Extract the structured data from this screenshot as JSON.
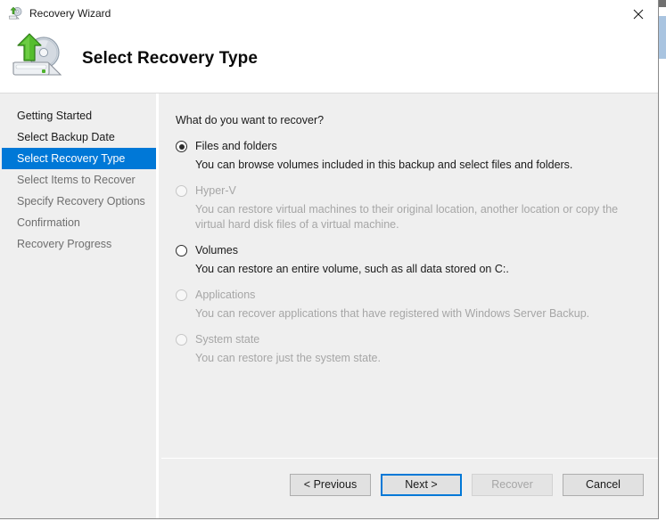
{
  "window": {
    "title": "Recovery Wizard",
    "title_icon": "recovery-disk-icon",
    "close_icon": "close-icon"
  },
  "header": {
    "icon": "recovery-disk-icon",
    "title": "Select Recovery Type"
  },
  "sidebar": {
    "items": [
      {
        "label": "Getting Started",
        "state": "done"
      },
      {
        "label": "Select Backup Date",
        "state": "done"
      },
      {
        "label": "Select Recovery Type",
        "state": "current"
      },
      {
        "label": "Select Items to Recover",
        "state": "upcoming"
      },
      {
        "label": "Specify Recovery Options",
        "state": "upcoming"
      },
      {
        "label": "Confirmation",
        "state": "upcoming"
      },
      {
        "label": "Recovery Progress",
        "state": "upcoming"
      }
    ]
  },
  "content": {
    "question": "What do you want to recover?",
    "options": [
      {
        "label": "Files and folders",
        "description": "You can browse volumes included in this backup and select files and folders.",
        "selected": true,
        "enabled": true
      },
      {
        "label": "Hyper-V",
        "description": "You can restore virtual machines to their original location, another location or copy the virtual hard disk files of a virtual machine.",
        "selected": false,
        "enabled": false
      },
      {
        "label": "Volumes",
        "description": "You can restore an entire volume, such as all data stored on C:.",
        "selected": false,
        "enabled": true
      },
      {
        "label": "Applications",
        "description": "You can recover applications that have registered with Windows Server Backup.",
        "selected": false,
        "enabled": false
      },
      {
        "label": "System state",
        "description": "You can restore just the system state.",
        "selected": false,
        "enabled": false
      }
    ]
  },
  "buttons": {
    "previous": "< Previous",
    "next": "Next >",
    "recover": "Recover",
    "cancel": "Cancel"
  },
  "colors": {
    "accent": "#0078d7",
    "body_bg": "#efefef",
    "disabled_text": "#a6a6a6",
    "scroll_thumb": "#a9c4e0"
  }
}
